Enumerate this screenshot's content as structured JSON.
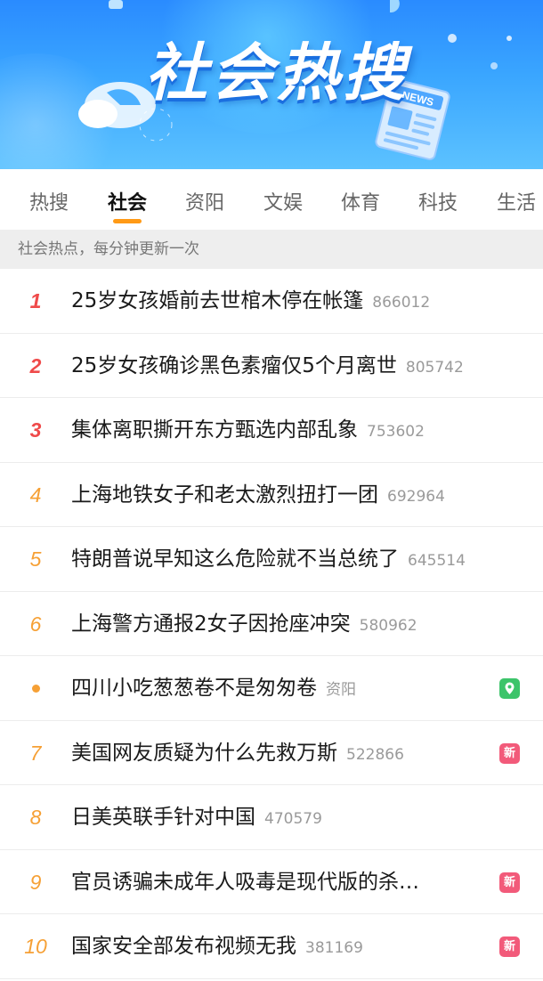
{
  "banner": {
    "title": "社会热搜",
    "news_label": "NEWS"
  },
  "tabs": [
    {
      "label": "热搜",
      "active": false
    },
    {
      "label": "社会",
      "active": true
    },
    {
      "label": "资阳",
      "active": false
    },
    {
      "label": "文娱",
      "active": false
    },
    {
      "label": "体育",
      "active": false
    },
    {
      "label": "科技",
      "active": false
    },
    {
      "label": "生活",
      "active": false
    }
  ],
  "notice": "社会热点，每分钟更新一次",
  "list": [
    {
      "rank": "1",
      "title": "25岁女孩婚前去世棺木停在帐篷",
      "heat": "866012",
      "badge": ""
    },
    {
      "rank": "2",
      "title": "25岁女孩确诊黑色素瘤仅5个月离世",
      "heat": "805742",
      "badge": ""
    },
    {
      "rank": "3",
      "title": "集体离职撕开东方甄选内部乱象",
      "heat": "753602",
      "badge": ""
    },
    {
      "rank": "4",
      "title": "上海地铁女子和老太激烈扭打一团",
      "heat": "692964",
      "badge": ""
    },
    {
      "rank": "5",
      "title": "特朗普说早知这么危险就不当总统了",
      "heat": "645514",
      "badge": ""
    },
    {
      "rank": "6",
      "title": "上海警方通报2女子因抢座冲突",
      "heat": "580962",
      "badge": ""
    },
    {
      "rank": "",
      "title": "四川小吃葱葱卷不是匆匆卷",
      "heat": "资阳",
      "badge": "location-icon"
    },
    {
      "rank": "7",
      "title": "美国网友质疑为什么先救万斯",
      "heat": "522866",
      "badge": "新"
    },
    {
      "rank": "8",
      "title": "日美英联手针对中国",
      "heat": "470579",
      "badge": ""
    },
    {
      "rank": "9",
      "title": "官员诱骗未成年人吸毒是现代版的杀…",
      "heat": "",
      "badge": "新"
    },
    {
      "rank": "10",
      "title": "国家安全部发布视频无我",
      "heat": "381169",
      "badge": "新"
    }
  ],
  "colors": {
    "top_rank": "#ef4a4a",
    "rank": "#f6a035",
    "new_badge": "#f25a7a",
    "location_badge": "#3cc46a",
    "tab_indicator": "#ff9a16"
  }
}
